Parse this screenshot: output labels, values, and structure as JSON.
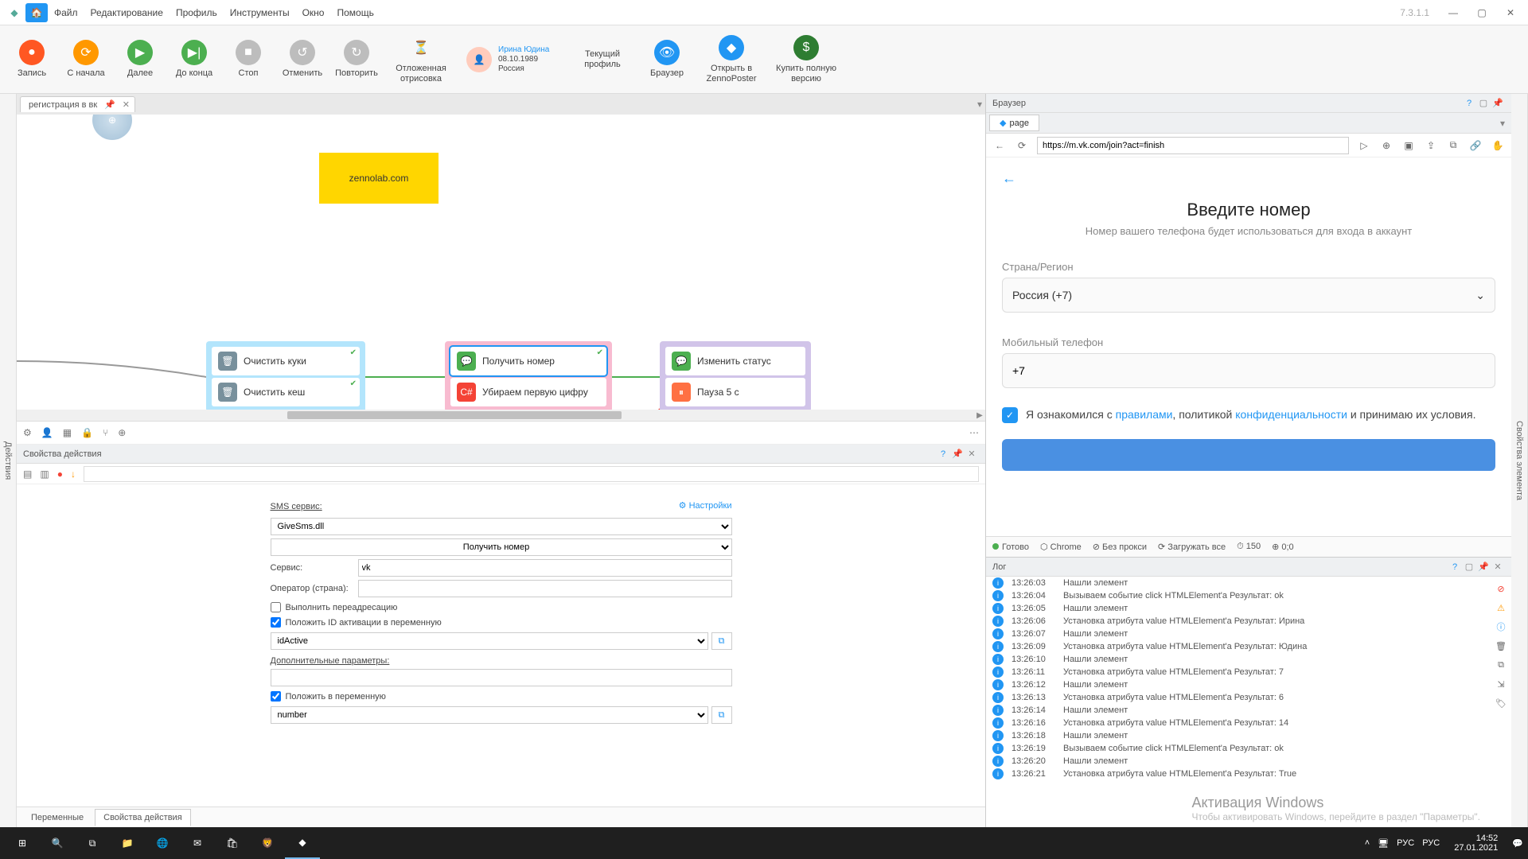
{
  "version": "7.3.1.1",
  "menu": {
    "file": "Файл",
    "edit": "Редактирование",
    "profile": "Профиль",
    "tools": "Инструменты",
    "window": "Окно",
    "help": "Помощь"
  },
  "ribbon": {
    "record": "Запись",
    "restart": "С начала",
    "next": "Далее",
    "to_end": "До конца",
    "stop": "Стоп",
    "cancel": "Отменить",
    "repeat": "Повторить",
    "deferred": "Отложенная отрисовка",
    "cur_profile": "Текущий профиль",
    "browser": "Браузер",
    "open_zp": "Открыть в ZennoPoster",
    "buy": "Купить полную версию",
    "profile": {
      "name": "Ирина Юдина",
      "dob": "08.10.1989",
      "country": "Россия"
    }
  },
  "side": {
    "left": "Действия",
    "right": "Свойства элемента"
  },
  "tab": {
    "name": "регистрация в вк"
  },
  "canvas": {
    "yellow": "zennolab.com",
    "b1r1": "Очистить куки",
    "b1r2": "Очистить кеш",
    "b2r1": "Получить номер",
    "b2r2": "Убираем первую цифру",
    "b3r1": "Изменить статус",
    "b3r2": "Пауза 5 с"
  },
  "props": {
    "title": "Свойства действия",
    "sms_label": "SMS сервис:",
    "settings": "Настройки",
    "dll": "GiveSms.dll",
    "action": "Получить номер",
    "service_label": "Сервис:",
    "service": "vk",
    "operator_label": "Оператор (страна):",
    "operator": "",
    "redirect": "Выполнить переадресацию",
    "put_id": "Положить ID активации в переменную",
    "id_var": "idActive",
    "extra": "Дополнительные параметры:",
    "put_var": "Положить в переменную",
    "var": "number"
  },
  "tabs": {
    "vars": "Переменные",
    "props": "Свойства действия"
  },
  "browser": {
    "panel": "Браузер",
    "page_tab": "page",
    "url": "https://m.vk.com/join?act=finish",
    "h1": "Введите номер",
    "sub": "Номер вашего телефона будет использоваться для входа в аккаунт",
    "country_label": "Страна/Регион",
    "country": "Россия (+7)",
    "phone_label": "Мобильный телефон",
    "phone": "+7",
    "agree_1": "Я ознакомился с ",
    "agree_rules": "правилами",
    "agree_2": ", политикой ",
    "agree_priv": "конфиденциальности",
    "agree_3": " и принимаю их условия.",
    "status": {
      "ready": "Готово",
      "chrome": "Chrome",
      "noproxy": "Без прокси",
      "load": "Загружать все",
      "num": "150",
      "coord": "0;0"
    }
  },
  "log_title": "Лог",
  "log": [
    {
      "t": "13:26:03",
      "m": "Нашли элемент"
    },
    {
      "t": "13:26:04",
      "m": "Вызываем событие click HTMLElement'а  Результат: ok"
    },
    {
      "t": "13:26:05",
      "m": "Нашли элемент"
    },
    {
      "t": "13:26:06",
      "m": "Установка атрибута value HTMLElement'а  Результат: Ирина"
    },
    {
      "t": "13:26:07",
      "m": "Нашли элемент"
    },
    {
      "t": "13:26:09",
      "m": "Установка атрибута value HTMLElement'а  Результат: Юдина"
    },
    {
      "t": "13:26:10",
      "m": "Нашли элемент"
    },
    {
      "t": "13:26:11",
      "m": "Установка атрибута value HTMLElement'а  Результат: 7"
    },
    {
      "t": "13:26:12",
      "m": "Нашли элемент"
    },
    {
      "t": "13:26:13",
      "m": "Установка атрибута value HTMLElement'а  Результат: 6"
    },
    {
      "t": "13:26:14",
      "m": "Нашли элемент"
    },
    {
      "t": "13:26:16",
      "m": "Установка атрибута value HTMLElement'а  Результат: 14"
    },
    {
      "t": "13:26:18",
      "m": "Нашли элемент"
    },
    {
      "t": "13:26:19",
      "m": "Вызываем событие click HTMLElement'а  Результат: ok"
    },
    {
      "t": "13:26:20",
      "m": "Нашли элемент"
    },
    {
      "t": "13:26:21",
      "m": "Установка атрибута value HTMLElement'а  Результат: True"
    }
  ],
  "tray": {
    "lang1": "РУС",
    "lang2": "РУС",
    "time": "14:52",
    "date": "27.01.2021"
  },
  "watermark": {
    "h": "Активация Windows",
    "s": "Чтобы активировать Windows, перейдите в раздел \"Параметры\"."
  }
}
